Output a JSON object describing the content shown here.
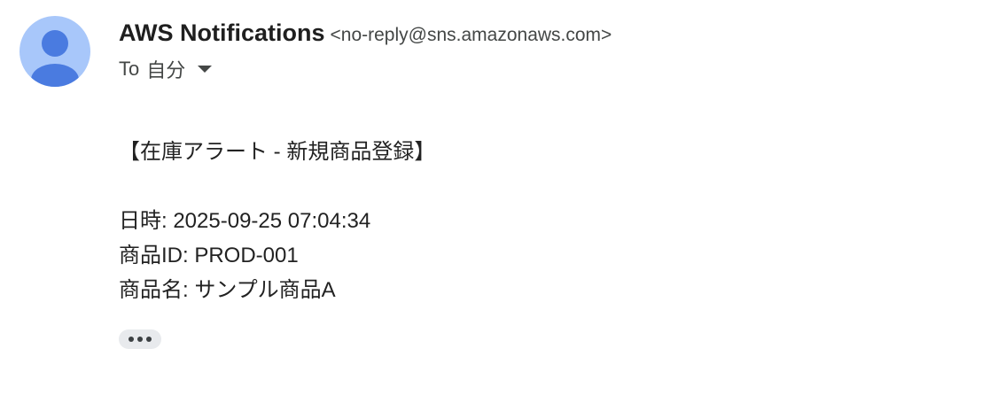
{
  "header": {
    "sender_name": "AWS Notifications",
    "sender_email": "<no-reply@sns.amazonaws.com>",
    "recipient_prefix": "To",
    "recipient": "自分",
    "avatar_icon": "person-icon",
    "dropdown_icon": "caret-down-icon"
  },
  "message": {
    "title": "【在庫アラート - 新規商品登録】",
    "datetime_line": "日時: 2025-09-25 07:04:34",
    "product_id_line": "商品ID: PROD-001",
    "product_name_line": "商品名: サンプル商品A",
    "more_icon": "ellipsis-icon"
  },
  "colors": {
    "avatar_bg": "#a8c7fa",
    "avatar_figure": "#4a7be0",
    "ellipsis_bg": "#e8eaed"
  }
}
